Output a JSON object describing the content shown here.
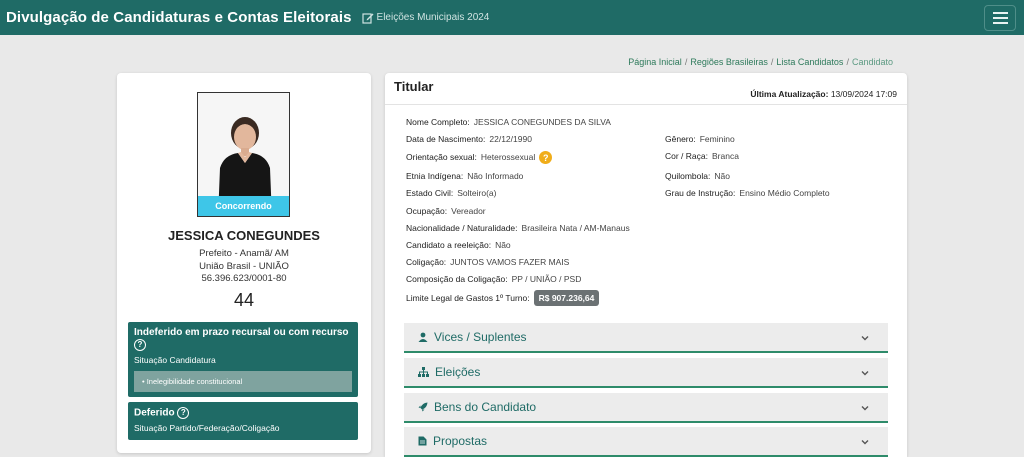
{
  "header": {
    "title": "Divulgação de Candidaturas e Contas Eleitorais",
    "election": "Eleições Municipais 2024"
  },
  "breadcrumb": [
    "Página Inicial",
    "Regiões Brasileiras",
    "Lista Candidatos",
    "Candidato"
  ],
  "candidate": {
    "photo_status": "Concorrendo",
    "name": "JESSICA CONEGUNDES",
    "office": "Prefeito - Anamã/ AM",
    "party": "União Brasil - UNIÃO",
    "cnpj": "56.396.623/0001-80",
    "number": "44"
  },
  "candidacy_status": {
    "title": "Indeferido em prazo recursal ou com recurso",
    "subtitle": "Situação Candidatura",
    "reason": "Inelegibilidade constitucional"
  },
  "party_status": {
    "title": "Deferido",
    "subtitle": "Situação Partido/Federação/Coligação"
  },
  "detail": {
    "heading": "Titular",
    "updated_label": "Última Atualização:",
    "updated_value": "13/09/2024 17:09",
    "fields": {
      "nome_label": "Nome Completo:",
      "nome": "JESSICA CONEGUNDES DA SILVA",
      "nasc_label": "Data de Nascimento:",
      "nasc": "22/12/1990",
      "genero_label": "Gênero:",
      "genero": "Feminino",
      "orient_label": "Orientação sexual:",
      "orient": "Heterossexual",
      "cor_label": "Cor / Raça:",
      "cor": "Branca",
      "etnia_label": "Etnia Indígena:",
      "etnia": "Não Informado",
      "quil_label": "Quilombola:",
      "quil": "Não",
      "civil_label": "Estado Civil:",
      "civil": "Solteiro(a)",
      "grau_label": "Grau de Instrução:",
      "grau": "Ensino Médio Completo",
      "ocup_label": "Ocupação:",
      "ocup": "Vereador",
      "nac_label": "Nacionalidade / Naturalidade:",
      "nac": "Brasileira Nata / AM-Manaus",
      "reel_label": "Candidato a reeleição:",
      "reel": "Não",
      "colig_label": "Coligação:",
      "colig": "JUNTOS VAMOS FAZER MAIS",
      "comp_label": "Composição da Coligação:",
      "comp": "PP / UNIÃO / PSD",
      "limite_label": "Limite Legal de Gastos 1º Turno:",
      "limite": "R$ 907.236,64"
    }
  },
  "accordions": [
    {
      "label": "Vices / Suplentes",
      "icon": "person-icon"
    },
    {
      "label": "Eleições",
      "icon": "sitemap-icon"
    },
    {
      "label": "Bens do Candidato",
      "icon": "rocket-icon"
    },
    {
      "label": "Propostas",
      "icon": "document-icon"
    }
  ],
  "colors": {
    "primary": "#1f6b66",
    "status_badge": "#3ec6e8",
    "accent_line": "#2e8b6a",
    "help_badge": "#f0ad1a"
  }
}
